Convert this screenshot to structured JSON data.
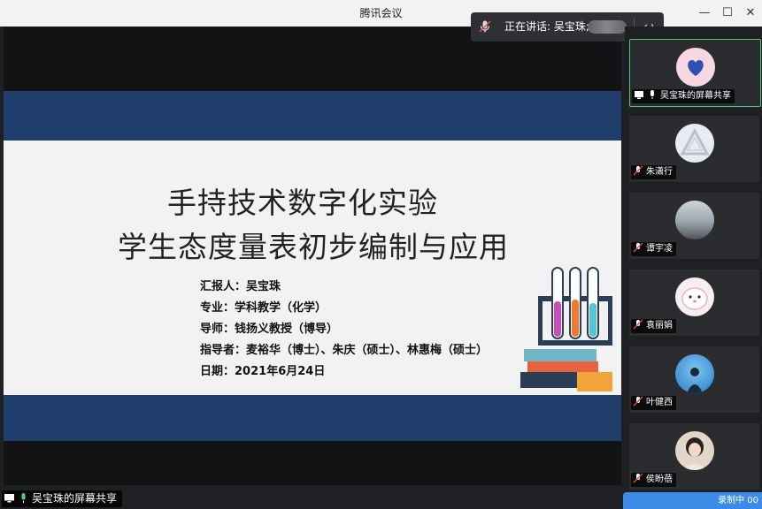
{
  "app": {
    "title": "腾讯会议"
  },
  "speaking": {
    "label": "正在讲话: 吴宝珠;"
  },
  "slide": {
    "title_line1": "手持技术数字化实验",
    "title_line2": "学生态度量表初步编制与应用",
    "info": [
      {
        "k": "汇报人：",
        "v": "吴宝珠"
      },
      {
        "k": "专业：",
        "v": "学科教学（化学）"
      },
      {
        "k": "导师：",
        "v": "钱扬义教授（博导）"
      },
      {
        "k": "指导者：",
        "v": "麦裕华（博士）、朱庆（硕士）、林惠梅（硕士）"
      },
      {
        "k": "日期：",
        "v": "2021年6月24日"
      }
    ]
  },
  "participants": [
    {
      "name": "吴宝珠的屏幕共享",
      "avatar_color": "#f6d7e2"
    },
    {
      "name": "朱潇行",
      "avatar_color": "#e8ecf2"
    },
    {
      "name": "谭宇凌",
      "avatar_color": "#9aa4ad"
    },
    {
      "name": "袁丽娟",
      "avatar_color": "#f7eef0"
    },
    {
      "name": "叶健西",
      "avatar_color": "#3e9de0"
    },
    {
      "name": "侯盼蓓",
      "avatar_color": "#e3d6c8"
    }
  ],
  "status": {
    "recording": "录制中  00"
  },
  "share_banner": {
    "label": "吴宝珠的屏幕共享"
  },
  "colors": {
    "band": "#1f3e6b",
    "active_border": "#55c27a",
    "recording_bg": "#3c8ce7"
  }
}
